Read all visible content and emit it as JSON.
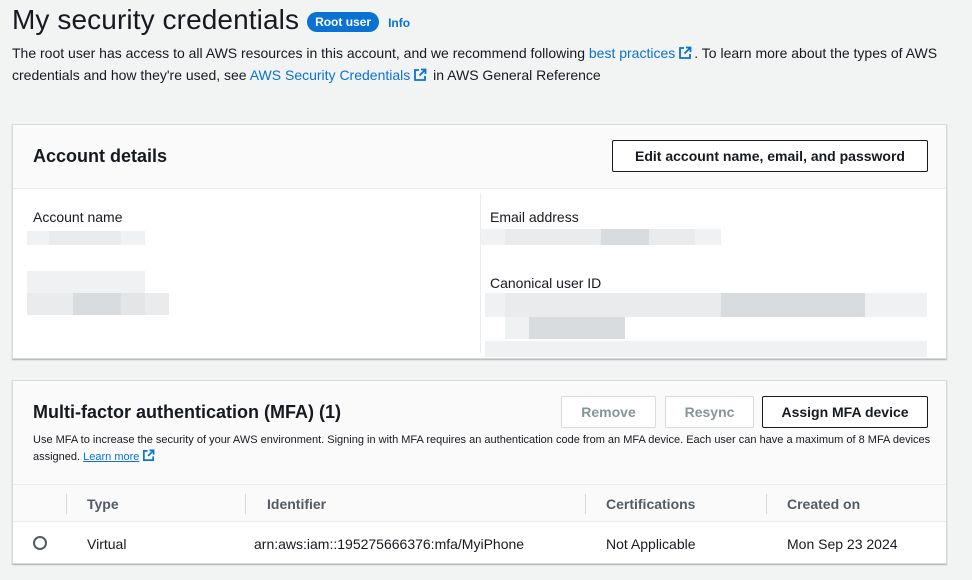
{
  "header": {
    "title": "My security credentials",
    "badge": "Root user",
    "info": "Info",
    "desc_part1": "The root user has access to all AWS resources in this account, and we recommend following ",
    "desc_link1": "best practices",
    "desc_part2": ". To learn more about the types of AWS credentials and how they're used, see ",
    "desc_link2": "AWS Security Credentials",
    "desc_part3": " in AWS General Reference"
  },
  "account": {
    "title": "Account details",
    "edit_button": "Edit account name, email, and password",
    "account_name_label": "Account name",
    "email_label": "Email address",
    "canonical_label": "Canonical user ID"
  },
  "mfa": {
    "title": "Multi-factor authentication (MFA) (1)",
    "remove": "Remove",
    "resync": "Resync",
    "assign": "Assign MFA device",
    "desc": "Use MFA to increase the security of your AWS environment. Signing in with MFA requires an authentication code from an MFA device. Each user can have a maximum of 8 MFA devices assigned.",
    "learn_more": "Learn more",
    "columns": [
      "Type",
      "Identifier",
      "Certifications",
      "Created on"
    ],
    "rows": [
      {
        "type": "Virtual",
        "identifier": "arn:aws:iam::195275666376:mfa/MyiPhone",
        "certifications": "Not Applicable",
        "created": "Mon Sep 23 2024"
      }
    ]
  },
  "colors": {
    "accent": "#0972d3",
    "background": "#f2f3f3"
  }
}
